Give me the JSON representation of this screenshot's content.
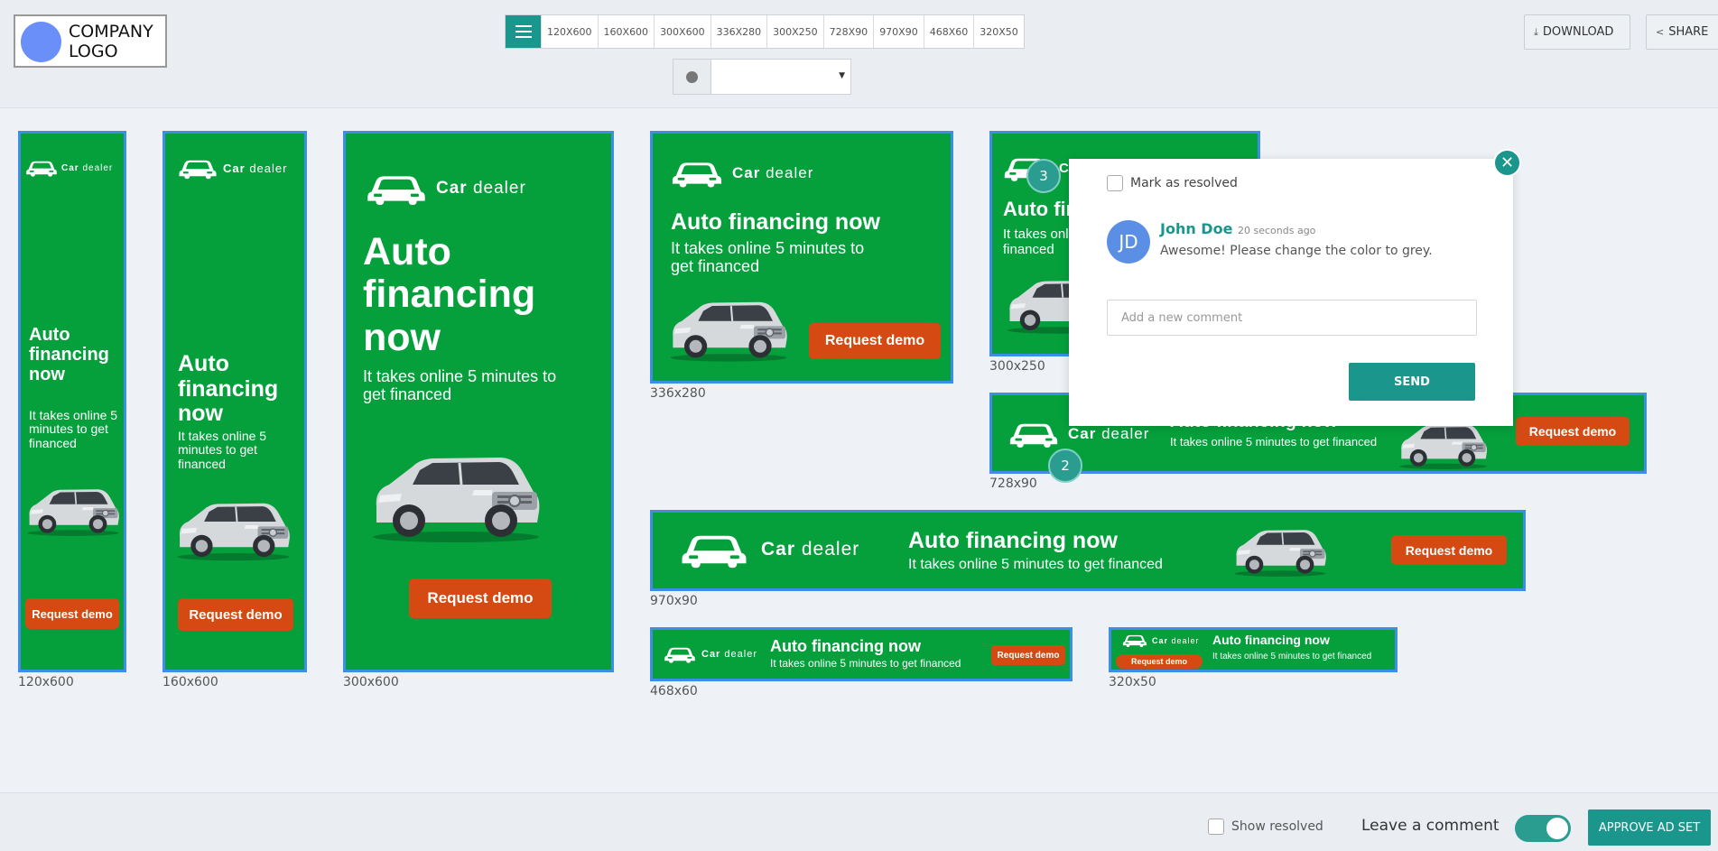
{
  "header": {
    "logo_text": "COMPANY\nLOGO",
    "size_buttons": [
      "120X600",
      "160X600",
      "300X600",
      "336X280",
      "300X250",
      "728X90",
      "970X90",
      "468X60",
      "320X50"
    ],
    "language_value": "",
    "download_label": "DOWNLOAD",
    "share_label": "SHARE"
  },
  "ad_copy": {
    "brand_bold": "Car",
    "brand_light": "dealer",
    "headline": "Auto financing now",
    "subline": "It takes online 5 minutes to get financed",
    "cta": "Request demo"
  },
  "ads": [
    {
      "label": "120x600"
    },
    {
      "label": "160x600"
    },
    {
      "label": "300x600"
    },
    {
      "label": "336x280"
    },
    {
      "label": "300x250"
    },
    {
      "label": "728x90"
    },
    {
      "label": "970x90"
    },
    {
      "label": "468x60"
    },
    {
      "label": "320x50"
    }
  ],
  "comment_popup": {
    "resolve_label": "Mark as resolved",
    "avatar_initials": "JD",
    "author": "John Doe",
    "time_ago": "20 seconds ago",
    "text": "Awesome! Please change the color to grey.",
    "input_placeholder": "Add a new comment",
    "send_label": "SEND",
    "close_glyph": "✕"
  },
  "badges": [
    "3",
    "2"
  ],
  "footer": {
    "show_resolved_label": "Show resolved",
    "leave_comment_label": "Leave a comment",
    "toggle_on": true,
    "approve_label": "APPROVE AD SET"
  },
  "colors": {
    "accent": "#1a968c",
    "ad_green": "#05a03c",
    "cta_orange": "#d44a12",
    "ad_border": "#3f8de6"
  },
  "icons": {
    "menu": "hamburger-icon",
    "globe": "globe-icon",
    "download": "download-icon",
    "share": "share-icon",
    "car_logo": "car-icon",
    "close": "close-icon"
  }
}
